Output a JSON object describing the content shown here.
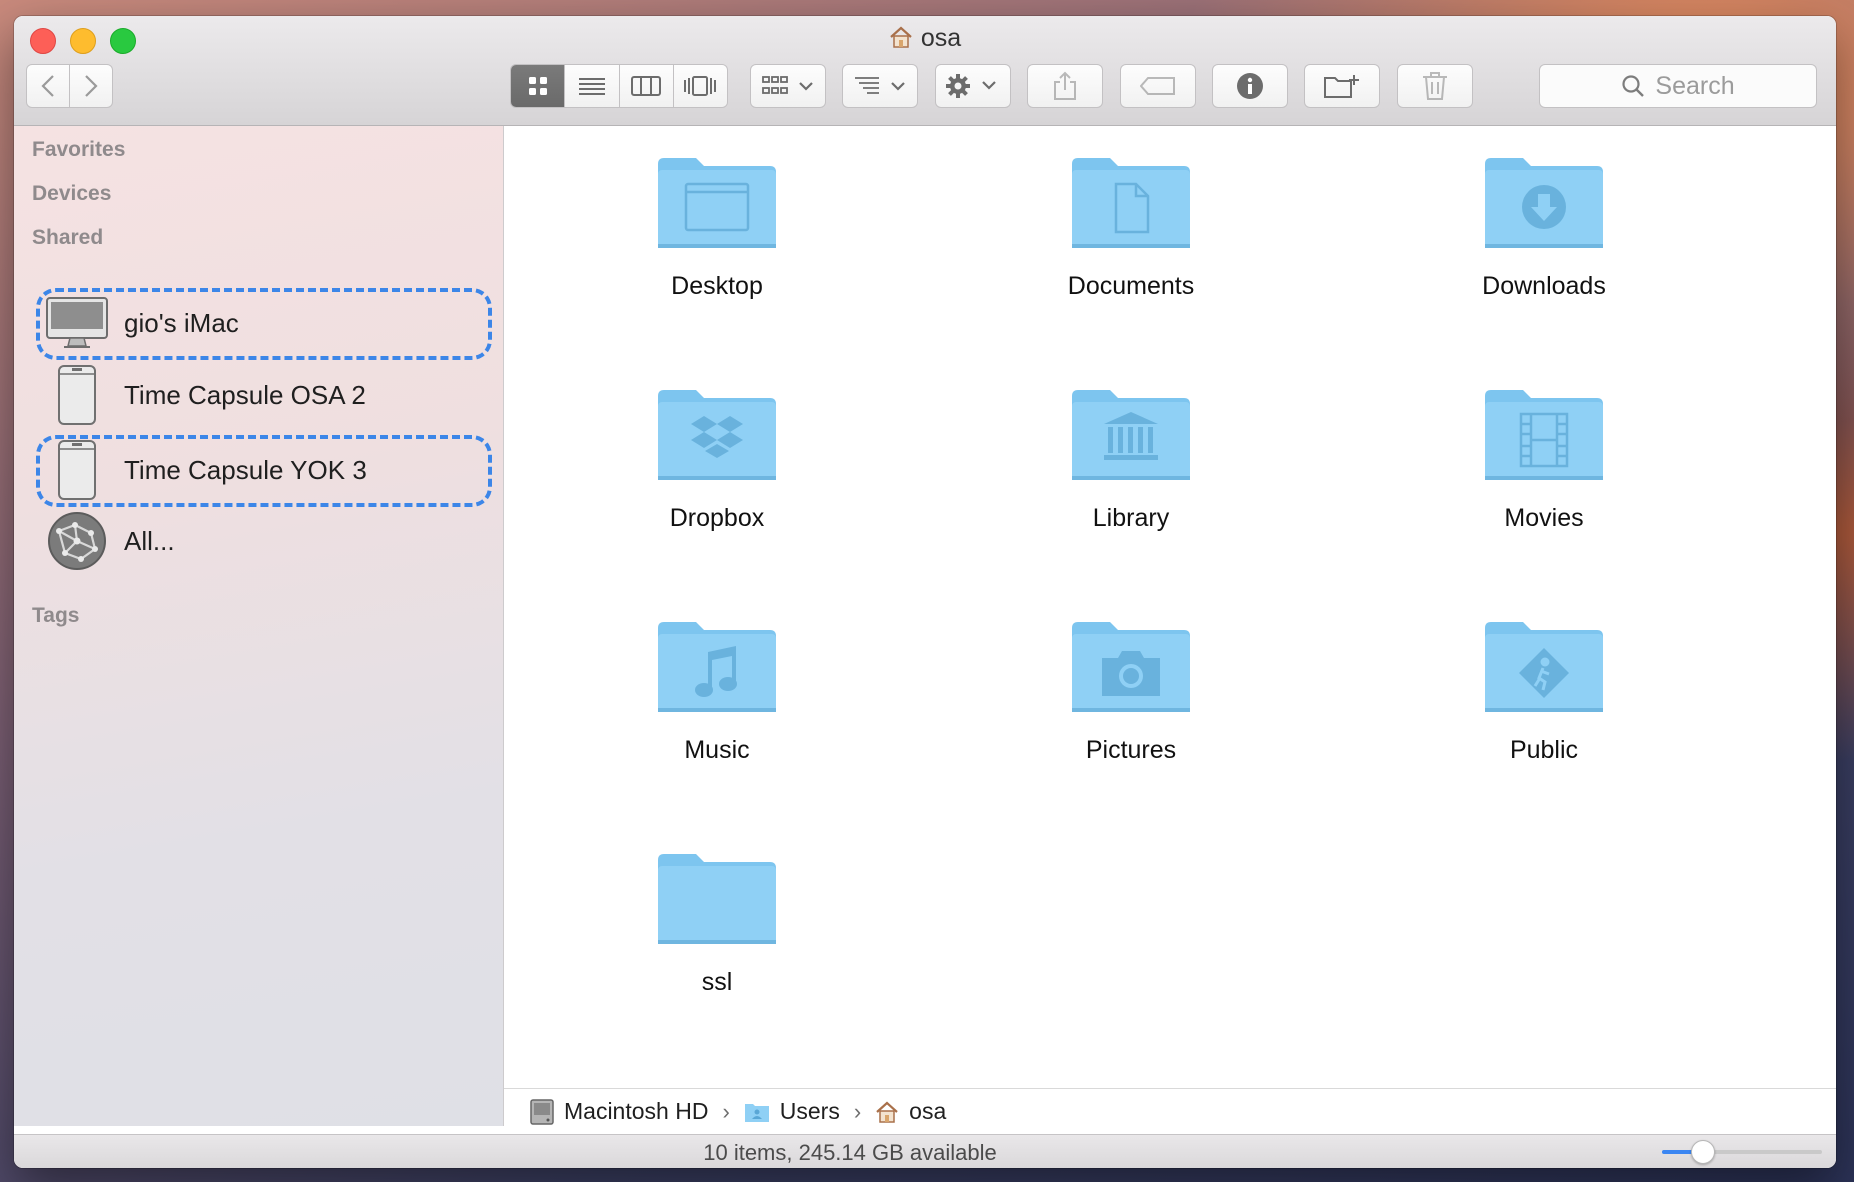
{
  "window": {
    "title": "osa"
  },
  "toolbar": {
    "back": "back-icon",
    "forward": "forward-icon",
    "view_modes": [
      "icon-view",
      "list-view",
      "column-view",
      "cover-flow-view"
    ],
    "active_view": "icon-view",
    "search_placeholder": "Search"
  },
  "sidebar": {
    "favorites": "Favorites",
    "devices": "Devices",
    "shared": "Shared",
    "shared_items": [
      {
        "label": "gio's iMac",
        "icon": "imac-icon",
        "highlighted": true
      },
      {
        "label": "Time Capsule OSA 2",
        "icon": "time-capsule-icon",
        "highlighted": false
      },
      {
        "label": "Time Capsule YOK 3",
        "icon": "time-capsule-icon",
        "highlighted": true
      },
      {
        "label": "All...",
        "icon": "network-icon",
        "highlighted": false
      }
    ],
    "tags": "Tags"
  },
  "files": [
    {
      "label": "Desktop",
      "icon": "desktop-folder-icon"
    },
    {
      "label": "Documents",
      "icon": "documents-folder-icon"
    },
    {
      "label": "Downloads",
      "icon": "downloads-folder-icon"
    },
    {
      "label": "Dropbox",
      "icon": "dropbox-folder-icon"
    },
    {
      "label": "Library",
      "icon": "library-folder-icon"
    },
    {
      "label": "Movies",
      "icon": "movies-folder-icon"
    },
    {
      "label": "Music",
      "icon": "music-folder-icon"
    },
    {
      "label": "Pictures",
      "icon": "pictures-folder-icon"
    },
    {
      "label": "Public",
      "icon": "public-folder-icon"
    },
    {
      "label": "ssl",
      "icon": "folder-icon"
    }
  ],
  "pathbar": [
    {
      "label": "Macintosh HD",
      "icon": "hard-drive-icon"
    },
    {
      "label": "Users",
      "icon": "users-folder-icon"
    },
    {
      "label": "osa",
      "icon": "home-icon"
    }
  ],
  "status": {
    "text": "10 items, 245.14 GB available",
    "icon_size_level": 0.25
  },
  "colors": {
    "accent": "#3b86f2",
    "folder": "#8fd0f5",
    "dashed_highlight": "#3c86e8"
  }
}
